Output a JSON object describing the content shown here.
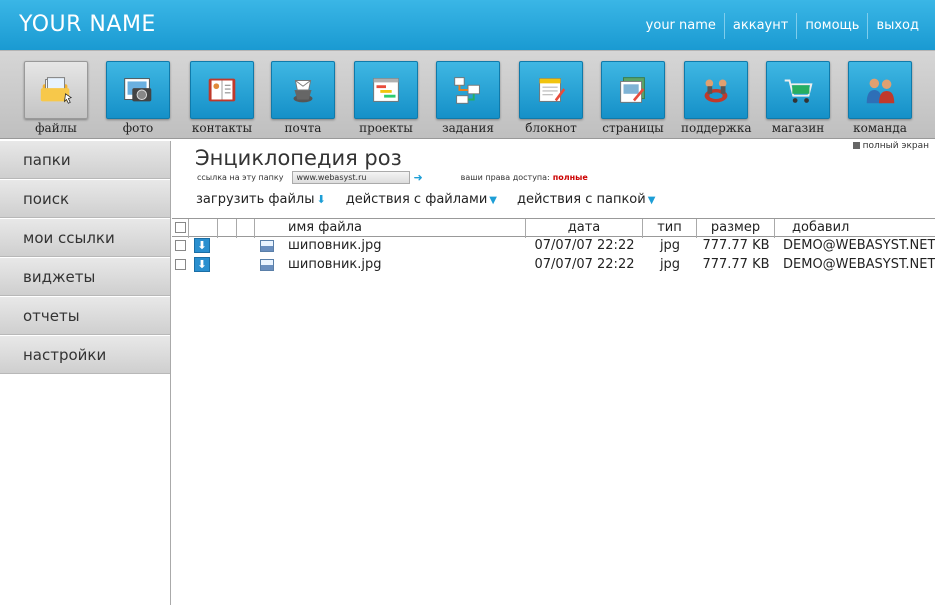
{
  "header": {
    "brand": "YOUR NAME",
    "nav": [
      "your name",
      "аккаунт",
      "помощь",
      "выход"
    ]
  },
  "toolbar": {
    "items": [
      {
        "label": "файлы",
        "icon": "files-icon"
      },
      {
        "label": "фото",
        "icon": "photo-icon"
      },
      {
        "label": "контакты",
        "icon": "contacts-icon"
      },
      {
        "label": "почта",
        "icon": "mail-icon"
      },
      {
        "label": "проекты",
        "icon": "projects-icon"
      },
      {
        "label": "задания",
        "icon": "tasks-icon"
      },
      {
        "label": "блокнот",
        "icon": "notepad-icon"
      },
      {
        "label": "страницы",
        "icon": "pages-icon"
      },
      {
        "label": "поддержка",
        "icon": "support-icon"
      },
      {
        "label": "магазин",
        "icon": "shop-icon"
      },
      {
        "label": "команда",
        "icon": "team-icon"
      }
    ]
  },
  "sidebar": {
    "items": [
      "папки",
      "поиск",
      "мои ссылки",
      "виджеты",
      "отчеты",
      "настройки"
    ]
  },
  "main": {
    "fullscreen": "полный экран",
    "title": "Энциклопедия роз",
    "link_label": "ссылка на эту папку",
    "link_value": "www.webasyst.ru",
    "rights_label": "ваши права доступа:",
    "rights_value": "полные",
    "actions": {
      "upload": "загрузить файлы",
      "file_actions": "действия с файлами",
      "folder_actions": "действия с папкой"
    }
  },
  "table": {
    "columns": {
      "name": "имя файла",
      "date": "дата",
      "type": "тип",
      "size": "размер",
      "added_by": "добавил"
    },
    "rows": [
      {
        "name": "шиповник.jpg",
        "date": "07/07/07 22:22",
        "type": "jpg",
        "size": "777.77 KB",
        "added_by": "DEMO@WEBASYST.NET"
      },
      {
        "name": "шиповник.jpg",
        "date": "07/07/07 22:22",
        "type": "jpg",
        "size": "777.77 KB",
        "added_by": "DEMO@WEBASYST.NET"
      }
    ]
  },
  "colors": {
    "header": "#1a9ad2",
    "accent": "#1d9ed6",
    "rights": "#cc0000"
  }
}
